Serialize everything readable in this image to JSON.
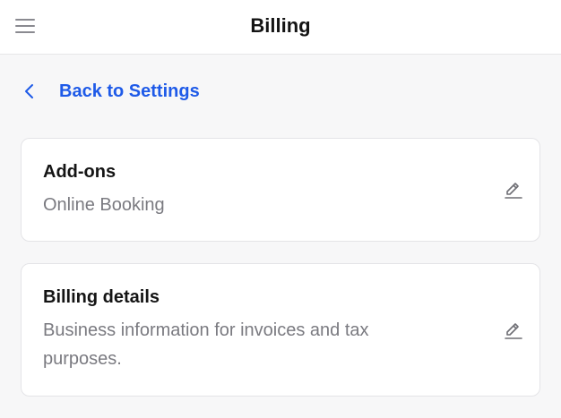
{
  "header": {
    "title": "Billing",
    "menu_icon": "hamburger-menu-icon"
  },
  "back": {
    "label": "Back to Settings",
    "icon": "chevron-left-icon"
  },
  "cards": [
    {
      "title": "Add-ons",
      "description": "Online Booking",
      "edit_icon": "pencil-edit-icon"
    },
    {
      "title": "Billing details",
      "description": "Business information for invoices and tax purposes.",
      "edit_icon": "pencil-edit-icon"
    }
  ],
  "colors": {
    "accent": "#1e5ae8",
    "background": "#f7f7f8",
    "card": "#ffffff",
    "muted_text": "#7a7a80"
  }
}
